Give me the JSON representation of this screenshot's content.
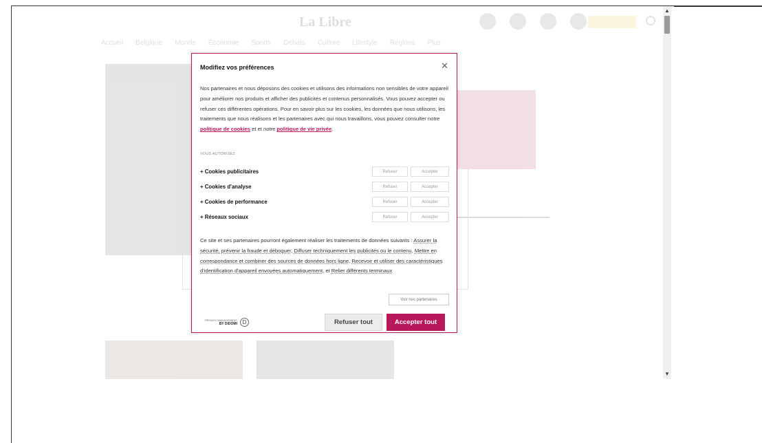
{
  "site": {
    "logo": "La Libre",
    "nav": [
      "Accueil",
      "Belgique",
      "Monde",
      "Économie",
      "Sports",
      "Débats",
      "Culture",
      "Lifestyle",
      "Regions",
      "Plus"
    ]
  },
  "modal": {
    "title": "Modifiez vos préférences",
    "close_icon": "close-icon",
    "intro_part1": "Nos partenaires et nous déposons des cookies et utilisons des informations non sensibles de votre appareil pour améliorer nos produits et afficher des publicités et contenus personnalisés. Vous pouvez accepter ou refuser ces différentes opérations. Pour en savoir plus sur les cookies, les données que nous utilisons, les traitements que nous réalisons et les partenaires avec qui nous travaillons, vous pouvez consulter notre ",
    "cookie_policy_link": "politique de cookies",
    "intro_part2": " et et notre ",
    "privacy_policy_link": "politique de vie privée",
    "intro_part3": ".",
    "section_label": "VOUS AUTORISEZ",
    "categories": [
      {
        "label": "+ Cookies publicitaires",
        "refuse": "Refuser",
        "accept": "Accepter"
      },
      {
        "label": "+ Cookies d'analyse",
        "refuse": "Refuser",
        "accept": "Accepter"
      },
      {
        "label": "+ Cookies de performance",
        "refuse": "Refuser",
        "accept": "Accepter"
      },
      {
        "label": "+ Réseaux sociaux",
        "refuse": "Refuser",
        "accept": "Accepter"
      }
    ],
    "purposes_intro": "Ce site et ses partenaires pourront également réaliser les traitements de données suivants : ",
    "purposes": [
      "Assurer la sécurité, prévenir la fraude et déboguer",
      "Diffuser techniquement les publicités ou le contenu",
      "Mettre en correspondance et combiner des sources de données hors ligne",
      "Recevoir et utiliser des caractéristiques d'identification d'appareil envoyées automatiquement",
      "Relier différents terminaux"
    ],
    "partners_button": "Voir nos partenaires",
    "didomi_line1": "PRIVACY MANAGEMENT",
    "didomi_line2": "BY DIDOMI",
    "refuse_all": "Refuser tout",
    "accept_all": "Accepter tout"
  },
  "colors": {
    "accent": "#b8175b"
  }
}
